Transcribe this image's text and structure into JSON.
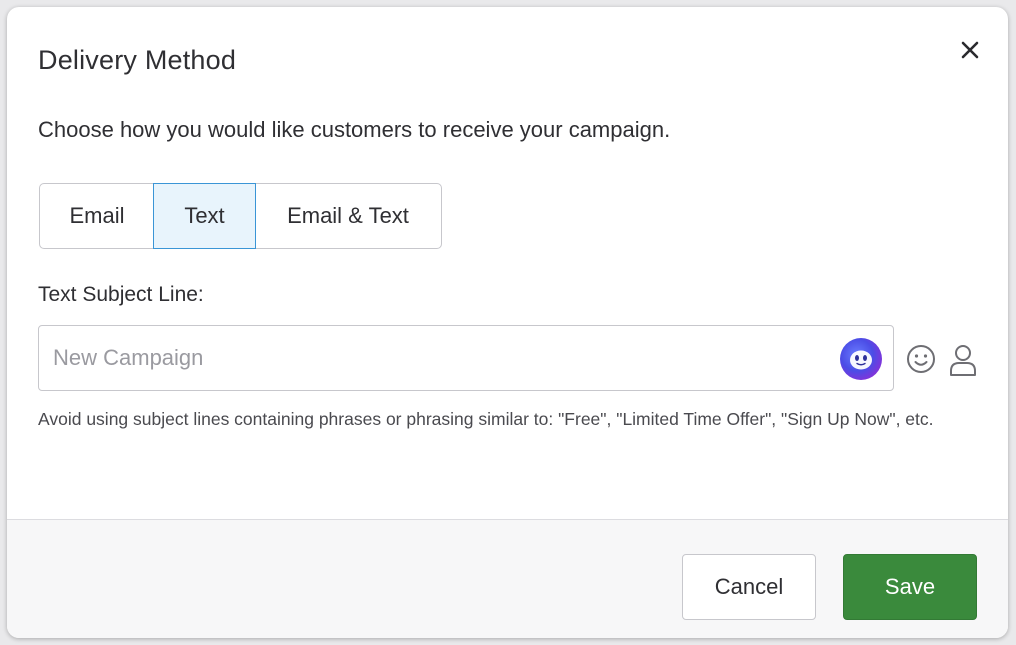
{
  "dialog": {
    "title": "Delivery Method",
    "instruction": "Choose how you would like customers to receive your campaign."
  },
  "delivery_options": [
    {
      "label": "Email",
      "selected": false
    },
    {
      "label": "Text",
      "selected": true
    },
    {
      "label": "Email & Text",
      "selected": false
    }
  ],
  "subject": {
    "label": "Text Subject Line:",
    "value": "",
    "placeholder": "New Campaign",
    "helper": "Avoid using subject lines containing phrases or phrasing similar to: \"Free\", \"Limited Time Offer\", \"Sign Up Now\", etc."
  },
  "icons": {
    "close": "close-icon",
    "ai_assistant": "ai-assistant-icon",
    "emoji": "emoji-icon",
    "personalize": "person-icon"
  },
  "footer": {
    "cancel_label": "Cancel",
    "save_label": "Save"
  },
  "colors": {
    "selected_border": "#3a95d6",
    "selected_bg": "#e8f4fc",
    "save_bg": "#3a8a3c",
    "ai_gradient_start": "#4b4de6",
    "ai_gradient_end": "#b02cc8"
  }
}
